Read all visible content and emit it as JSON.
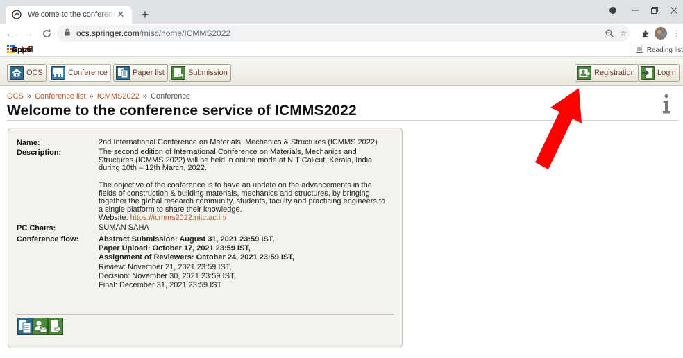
{
  "browser": {
    "tab_title": "Welcome to the conference servi",
    "url_host": "ocs.springer.com",
    "url_path": "/misc/home/ICMMS2022",
    "bookmarks": [
      {
        "label": "Apps",
        "icon": "apps-grid-icon"
      },
      {
        "label": "Gmail",
        "icon": "gmail-icon"
      }
    ],
    "reading_list": "Reading list"
  },
  "menu": {
    "left": [
      {
        "label": "OCS",
        "icon": "home-icon"
      },
      {
        "label": "Conference",
        "icon": "conference-icon"
      },
      {
        "label": "Paper list",
        "icon": "paper-list-icon"
      },
      {
        "label": "Submission",
        "icon": "submission-icon"
      }
    ],
    "right": [
      {
        "label": "Registration",
        "icon": "registration-icon"
      },
      {
        "label": "Login",
        "icon": "login-icon"
      }
    ]
  },
  "breadcrumb": {
    "items": [
      "OCS",
      "Conference list",
      "ICMMS2022"
    ],
    "current": "Conference",
    "separator": "»"
  },
  "page_title": "Welcome to the conference service of ICMMS2022",
  "conference": {
    "name_label": "Name:",
    "name": "2nd International Conference on Materials, Mechanics & Structures (ICMMS 2022)",
    "description_label": "Description:",
    "description_p1": "The second edition of International Conference on Materials, Mechanics and Structures (ICMMS 2022) will be held in online mode at NIT Calicut, Kerala, India during 10th – 12th March, 2022.",
    "description_p2": "The objective of the conference is to have an update on the advancements in the fields of construction & building materials, mechanics and structures, by bringing together the global research community, students, faculty and practicing engineers to a single platform to share their knowledge.",
    "website_label": "Website: ",
    "website_url": "https://icmms2022.nitc.ac.in/",
    "pc_chairs_label": "PC Chairs:",
    "pc_chairs": "SUMAN SAHA",
    "flow_label": "Conference flow:",
    "flow": [
      {
        "text": "Abstract Submission: August 31, 2021 23:59 IST,",
        "bold": true
      },
      {
        "text": "Paper Upload: October 17, 2021 23:59 IST,",
        "bold": true
      },
      {
        "text": "Assignment of Reviewers: October 24, 2021 23:59 IST,",
        "bold": true
      },
      {
        "text": "Review: November 21, 2021 23:59 IST,",
        "bold": false
      },
      {
        "text": "Decision: November 30, 2021 23:59 IST,",
        "bold": false
      },
      {
        "text": "Final: December 31, 2021 23:59 IST",
        "bold": false
      }
    ]
  },
  "actions": [
    "paper-list-action-icon",
    "contact-mail-icon",
    "submission-action-icon"
  ],
  "colors": {
    "link": "#b05a2c",
    "annotation_arrow": "#ff0000",
    "menu_bg": "#ebe9e0",
    "card_bg": "#f3f2ee"
  }
}
